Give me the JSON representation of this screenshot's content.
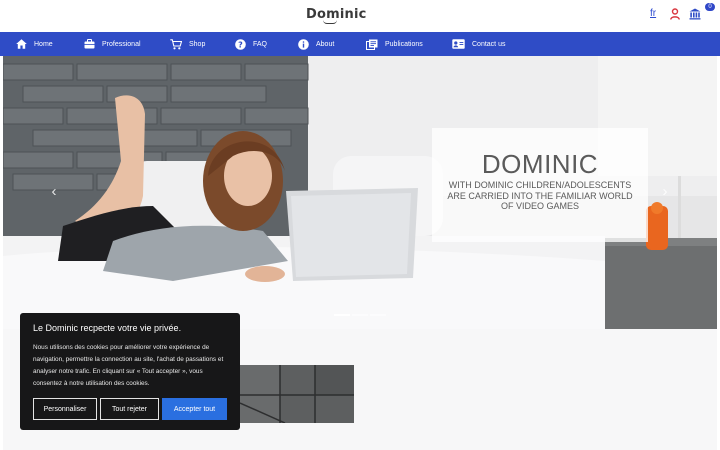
{
  "header": {
    "logo": "Dominic",
    "lang": "fr",
    "badge_count": "0"
  },
  "nav": {
    "items": [
      {
        "label": "Home",
        "icon": "home-icon"
      },
      {
        "label": "Professional",
        "icon": "briefcase-icon"
      },
      {
        "label": "Shop",
        "icon": "cart-icon"
      },
      {
        "label": "FAQ",
        "icon": "question-icon"
      },
      {
        "label": "About",
        "icon": "info-icon"
      },
      {
        "label": "Publications",
        "icon": "publications-icon"
      },
      {
        "label": "Contact us",
        "icon": "contact-card-icon"
      }
    ]
  },
  "hero": {
    "title": "DOMINIC",
    "subtitle": "WITH DOMINIC CHILDREN/ADOLESCENTS ARE CARRIED INTO THE FAMILIAR WORLD OF VIDEO GAMES",
    "prev_arrow": "‹",
    "next_arrow": "›",
    "slide_count": 3,
    "active_slide": 1
  },
  "cookie": {
    "title": "Le Dominic recpecte votre vie privée.",
    "text": "Nous utilisons des cookies pour améliorer votre expérience de navigation, permettre la connection au site, l'achat de passations et analyser notre trafic. En cliquant sur « Tout accepter », vous consentez à notre utilisation des cookies.",
    "customize_label": "Personnaliser",
    "reject_label": "Tout rejeter",
    "accept_label": "Accepter tout"
  },
  "colors": {
    "nav_bg": "#2f4cc6",
    "accept_btn": "#2a6fe0",
    "cookie_bg": "#171718"
  }
}
